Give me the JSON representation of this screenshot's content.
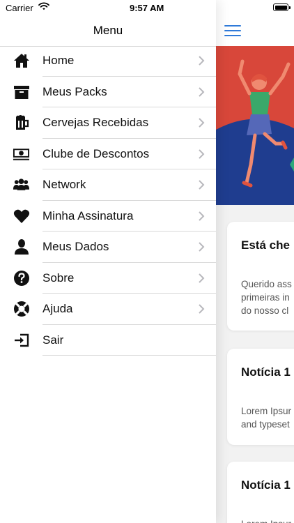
{
  "status_bar": {
    "carrier": "Carrier",
    "time": "9:57 AM"
  },
  "drawer": {
    "title": "Menu",
    "items": [
      {
        "label": "Home",
        "icon": "home-icon"
      },
      {
        "label": "Meus Packs",
        "icon": "archive-box-icon"
      },
      {
        "label": "Cervejas Recebidas",
        "icon": "beer-mug-icon"
      },
      {
        "label": "Clube de Descontos",
        "icon": "money-icon"
      },
      {
        "label": "Network",
        "icon": "group-icon"
      },
      {
        "label": "Minha Assinatura",
        "icon": "heart-icon"
      },
      {
        "label": "Meus Dados",
        "icon": "user-icon"
      },
      {
        "label": "Sobre",
        "icon": "question-icon"
      },
      {
        "label": "Ajuda",
        "icon": "lifebuoy-icon"
      },
      {
        "label": "Sair",
        "icon": "logout-icon"
      }
    ]
  },
  "content": {
    "cards": [
      {
        "title": "Está che",
        "body_line1": "Querido ass",
        "body_line2": "primeiras in",
        "body_line3": "do nosso cl"
      },
      {
        "title": "Notícia 1",
        "body_line1": "Lorem Ipsur",
        "body_line2": "and typeset"
      },
      {
        "title": "Notícia 1",
        "body_line1": "Lorem Ipsur"
      }
    ]
  },
  "colors": {
    "accent": "#2f7ad9",
    "banner_red": "#d8473a",
    "banner_blue": "#1f3d8f"
  }
}
